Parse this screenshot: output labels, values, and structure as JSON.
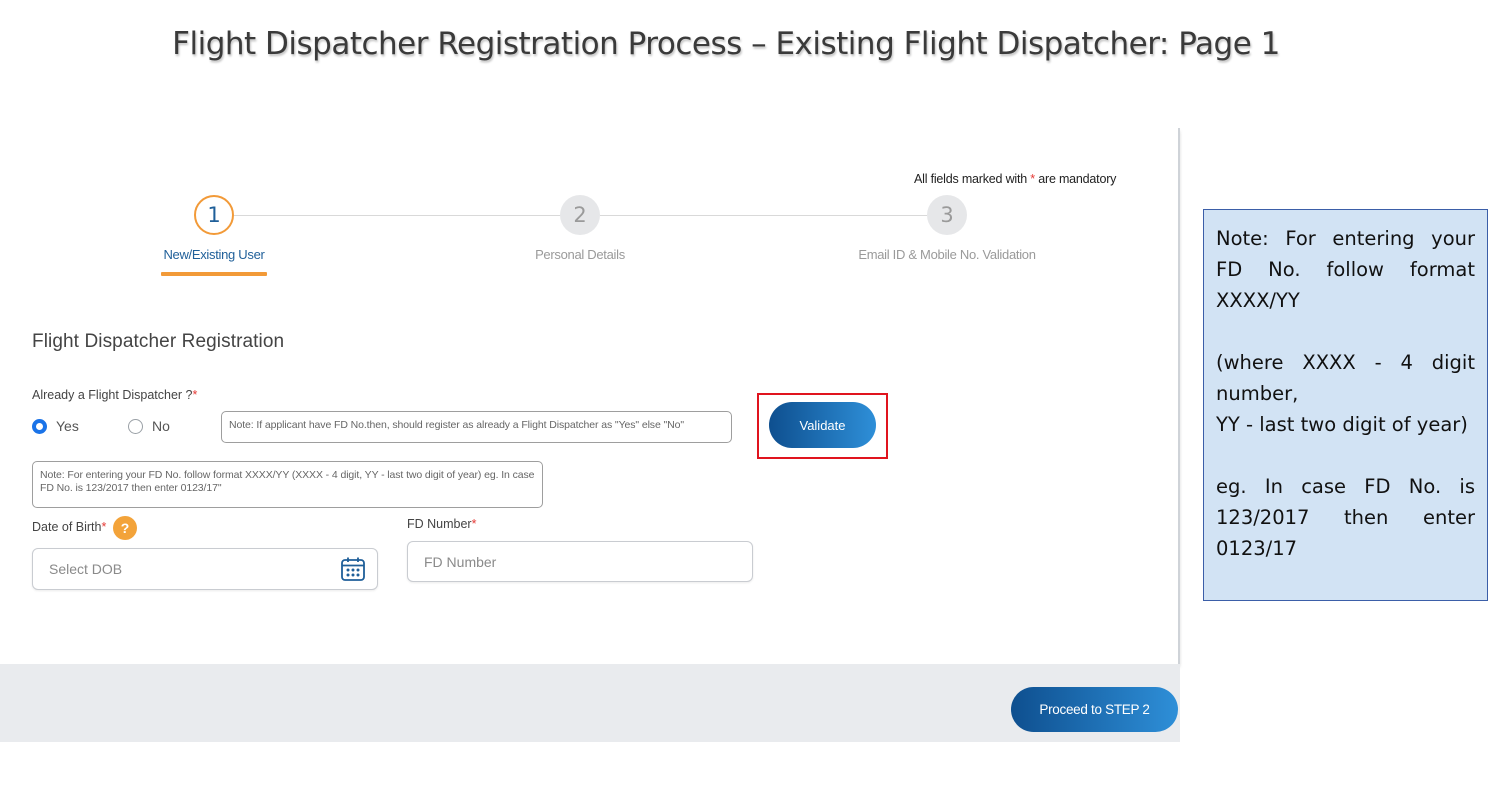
{
  "slide": {
    "title": "Flight Dispatcher Registration Process – Existing Flight Dispatcher: Page 1"
  },
  "form": {
    "mandatory_prefix": "All fields marked with ",
    "mandatory_star": "*",
    "mandatory_suffix": " are mandatory",
    "steps": [
      {
        "number": "1",
        "label": "New/Existing User",
        "state": "active"
      },
      {
        "number": "2",
        "label": "Personal Details",
        "state": "inactive"
      },
      {
        "number": "3",
        "label": "Email ID & Mobile No. Validation",
        "state": "inactive"
      }
    ],
    "section_title": "Flight Dispatcher Registration",
    "question_label": "Already a Flight Dispatcher ?",
    "required_mark": "*",
    "radio_yes": "Yes",
    "radio_no": "No",
    "selected_option": "Yes",
    "note_applicant": "Note: If applicant have FD No.then, should register as already a Flight Dispatcher as \"Yes\" else \"No\"",
    "note_format": "Note: For entering your FD No. follow format XXXX/YY (XXXX - 4 digit, YY - last two digit of year) eg. In case FD No. is 123/2017 then enter 0123/17\"",
    "dob_label": "Date of Birth",
    "help_glyph": "?",
    "dob_placeholder": "Select DOB",
    "fd_label": "FD Number",
    "fd_placeholder": "FD Number",
    "validate_label": "Validate",
    "proceed_label": "Proceed to STEP 2"
  },
  "side_note": {
    "line1": "Note: For entering your FD No. follow format XXXX/YY",
    "line2": "(where XXXX - 4 digit number,",
    "line3": "YY - last two digit of year)",
    "line4": "eg. In case FD No. is 123/2017 then enter 0123/17"
  },
  "colors": {
    "accent_orange": "#f29a38",
    "primary_blue": "#1f5f99",
    "highlight_red": "#e0141e",
    "note_bg": "#d2e3f4"
  },
  "icons": {
    "calendar": "calendar-icon",
    "help": "question-icon"
  }
}
